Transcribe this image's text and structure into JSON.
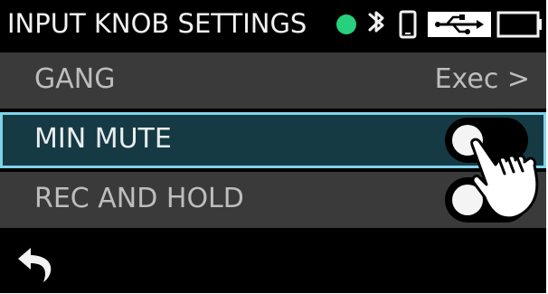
{
  "header": {
    "title": "INPUT KNOB SETTINGS",
    "status_icons": [
      "status-dot-green",
      "bluetooth-icon",
      "phone-icon",
      "usb-icon",
      "battery-icon"
    ]
  },
  "menu": {
    "items": [
      {
        "label": "GANG",
        "value": "Exec >"
      },
      {
        "label": "MIN MUTE",
        "toggle": "off"
      },
      {
        "label": "REC AND HOLD",
        "toggle": "off"
      }
    ]
  },
  "colors": {
    "header_bg": "#000000",
    "row_bg": "#3a3a3a",
    "selected_row_bg": "#163a44",
    "selected_outline": "#7fd3e8",
    "status_green": "#26d07c"
  },
  "footer": {
    "back_icon": "back-arrow-icon"
  }
}
